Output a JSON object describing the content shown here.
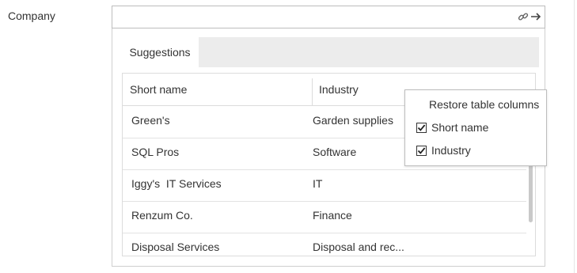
{
  "form": {
    "company_label": "Company",
    "company_value": ""
  },
  "icons": {
    "link": "link-icon",
    "navigate": "arrow-right-icon"
  },
  "suggestions": {
    "tab_label": "Suggestions",
    "columns": [
      "Short name",
      "Industry"
    ],
    "rows": [
      {
        "short_name": "Green's",
        "industry": "Garden supplies"
      },
      {
        "short_name": "SQL Pros",
        "industry": "Software"
      },
      {
        "short_name": "Iggy's  IT Services",
        "industry": "IT"
      },
      {
        "short_name": "Renzum Co.",
        "industry": "Finance"
      },
      {
        "short_name": "Disposal Services",
        "industry": "Disposal and rec..."
      }
    ]
  },
  "column_menu": {
    "title": "Restore table columns",
    "items": [
      {
        "label": "Short name",
        "checked": true
      },
      {
        "label": "Industry",
        "checked": true
      }
    ]
  }
}
